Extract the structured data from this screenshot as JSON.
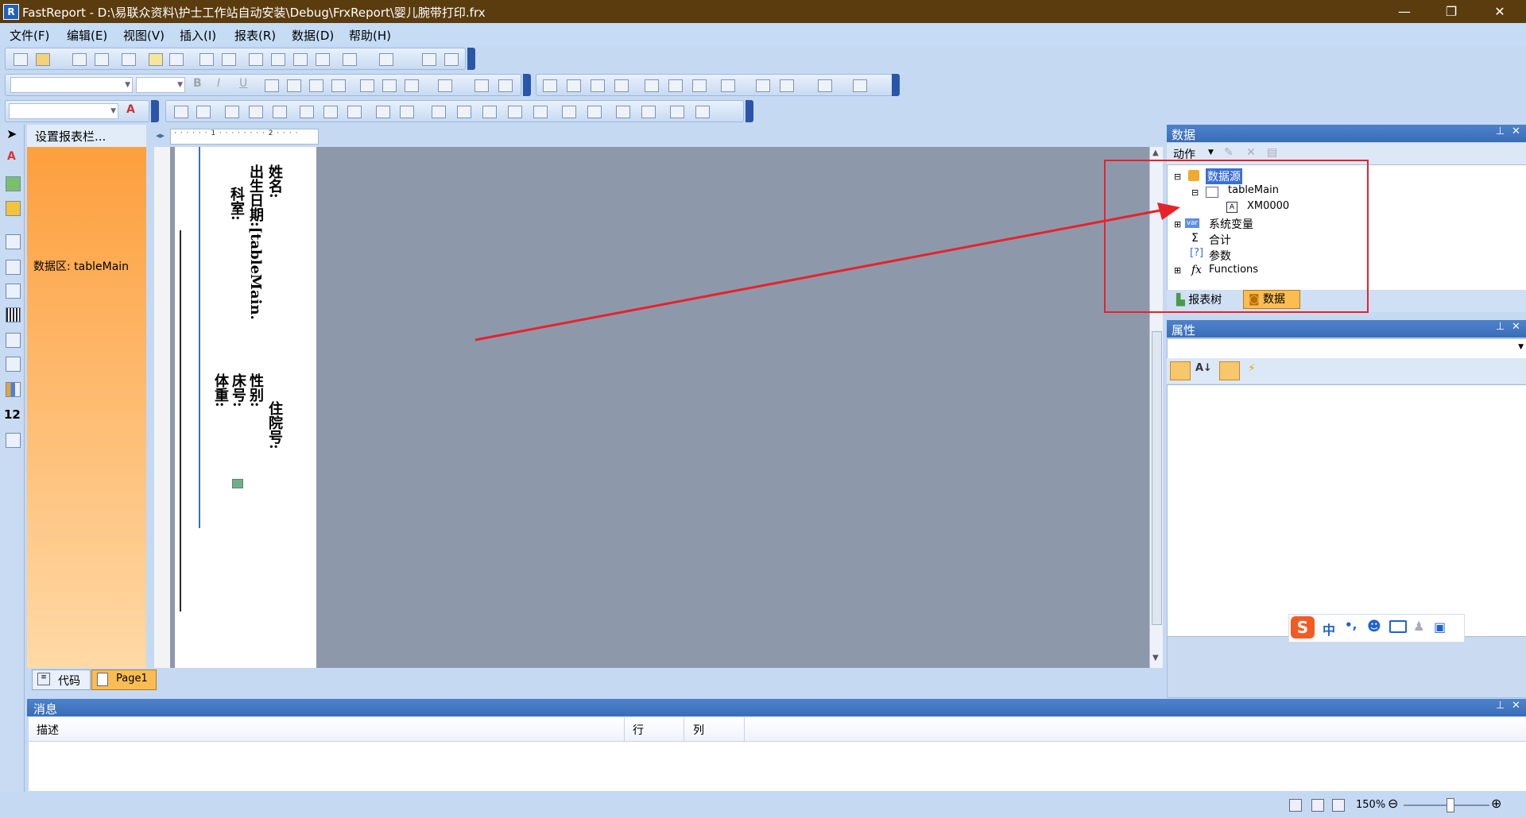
{
  "window": {
    "title": "FastReport - D:\\易联众资料\\护士工作站自动安装\\Debug\\FrxReport\\婴儿腕带打印.frx",
    "app_icon": "fastreport-icon",
    "minimize": "—",
    "restore": "❐",
    "close": "✕"
  },
  "menu": [
    "文件(F)",
    "编辑(E)",
    "视图(V)",
    "插入(I)",
    "报表(R)",
    "数据(D)",
    "帮助(H)"
  ],
  "band_panel": {
    "header": "设置报表栏...",
    "band_label": "数据区: tableMain"
  },
  "design": {
    "texts": {
      "name": "姓名:",
      "birth": "出生日期:[tableMain.",
      "dept": "科室:",
      "gender": "性别:",
      "bed": "床号:",
      "weight": "体重:",
      "inpatient_no": "住院号:"
    }
  },
  "data_panel": {
    "title": "数据",
    "action": "动作",
    "tree": {
      "datasource": "数据源",
      "table": "tableMain",
      "field": "XM0000",
      "sysvars": "系统变量",
      "total": "合计",
      "params": "参数",
      "functions": "Functions"
    },
    "tabs": {
      "report_tree": "报表树",
      "data": "数据"
    }
  },
  "properties_panel": {
    "title": "属性"
  },
  "ime_bar": {
    "logo": "S",
    "lang": "中",
    "punct": "•,"
  },
  "page_tabs": {
    "code": "代码",
    "page1": "Page1"
  },
  "messages": {
    "title": "消息",
    "col_desc": "描述",
    "col_row": "行",
    "col_col": "列"
  },
  "status": {
    "zoom": "150%"
  },
  "colors": {
    "titlebar": "#5b3c0f",
    "band": "#fd9f3d",
    "panel_header": "#3a6db8",
    "highlight_box": "#e8222a",
    "canvas": "#8d99ab"
  }
}
